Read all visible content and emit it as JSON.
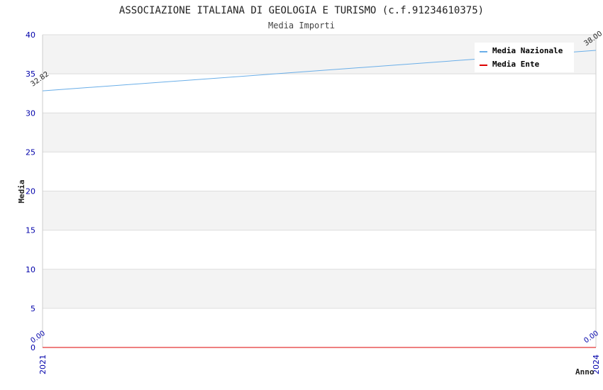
{
  "chart_data": {
    "type": "line",
    "title": "ASSOCIAZIONE ITALIANA DI GEOLOGIA E TURISMO (c.f.91234610375)",
    "subtitle": "Media Importi",
    "xlabel": "Anno",
    "ylabel": "Media",
    "x": [
      "2021",
      "2024"
    ],
    "ylim": [
      0,
      40
    ],
    "yticks": [
      0,
      5,
      10,
      15,
      20,
      25,
      30,
      35,
      40
    ],
    "grid": true,
    "legend_position": "top-right",
    "series": [
      {
        "name": "Media Nazionale",
        "color": "#6aaee8",
        "values": [
          32.82,
          38.0
        ],
        "labels": [
          "32.82",
          "38.00"
        ]
      },
      {
        "name": "Media Ente",
        "color": "#dd0000",
        "values": [
          0.0,
          0.0
        ],
        "labels": [
          "0.00",
          "0.00"
        ]
      }
    ]
  }
}
